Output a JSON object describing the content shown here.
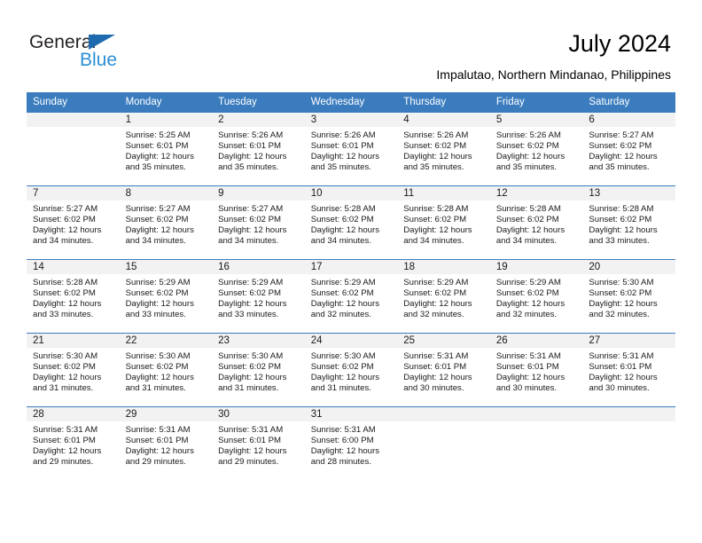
{
  "brand": {
    "name_top": "General",
    "name_bottom": "Blue",
    "color_dark": "#231f20",
    "color_blue": "#2b8fd4",
    "triangle_color": "#1f6bb0"
  },
  "header": {
    "title": "July 2024",
    "subtitle": "Impalutao, Northern Mindanao, Philippines"
  },
  "theme": {
    "header_bg": "#3a7cbe",
    "header_text": "#ffffff",
    "daynum_bg": "#f2f2f2",
    "grid_line": "#3a7cbe"
  },
  "calendar": {
    "weekday_headers": [
      "Sunday",
      "Monday",
      "Tuesday",
      "Wednesday",
      "Thursday",
      "Friday",
      "Saturday"
    ],
    "weeks": [
      [
        {
          "day": "",
          "sunrise": "",
          "sunset": "",
          "daylight_line1": "",
          "daylight_line2": ""
        },
        {
          "day": "1",
          "sunrise": "Sunrise: 5:25 AM",
          "sunset": "Sunset: 6:01 PM",
          "daylight_line1": "Daylight: 12 hours",
          "daylight_line2": "and 35 minutes."
        },
        {
          "day": "2",
          "sunrise": "Sunrise: 5:26 AM",
          "sunset": "Sunset: 6:01 PM",
          "daylight_line1": "Daylight: 12 hours",
          "daylight_line2": "and 35 minutes."
        },
        {
          "day": "3",
          "sunrise": "Sunrise: 5:26 AM",
          "sunset": "Sunset: 6:01 PM",
          "daylight_line1": "Daylight: 12 hours",
          "daylight_line2": "and 35 minutes."
        },
        {
          "day": "4",
          "sunrise": "Sunrise: 5:26 AM",
          "sunset": "Sunset: 6:02 PM",
          "daylight_line1": "Daylight: 12 hours",
          "daylight_line2": "and 35 minutes."
        },
        {
          "day": "5",
          "sunrise": "Sunrise: 5:26 AM",
          "sunset": "Sunset: 6:02 PM",
          "daylight_line1": "Daylight: 12 hours",
          "daylight_line2": "and 35 minutes."
        },
        {
          "day": "6",
          "sunrise": "Sunrise: 5:27 AM",
          "sunset": "Sunset: 6:02 PM",
          "daylight_line1": "Daylight: 12 hours",
          "daylight_line2": "and 35 minutes."
        }
      ],
      [
        {
          "day": "7",
          "sunrise": "Sunrise: 5:27 AM",
          "sunset": "Sunset: 6:02 PM",
          "daylight_line1": "Daylight: 12 hours",
          "daylight_line2": "and 34 minutes."
        },
        {
          "day": "8",
          "sunrise": "Sunrise: 5:27 AM",
          "sunset": "Sunset: 6:02 PM",
          "daylight_line1": "Daylight: 12 hours",
          "daylight_line2": "and 34 minutes."
        },
        {
          "day": "9",
          "sunrise": "Sunrise: 5:27 AM",
          "sunset": "Sunset: 6:02 PM",
          "daylight_line1": "Daylight: 12 hours",
          "daylight_line2": "and 34 minutes."
        },
        {
          "day": "10",
          "sunrise": "Sunrise: 5:28 AM",
          "sunset": "Sunset: 6:02 PM",
          "daylight_line1": "Daylight: 12 hours",
          "daylight_line2": "and 34 minutes."
        },
        {
          "day": "11",
          "sunrise": "Sunrise: 5:28 AM",
          "sunset": "Sunset: 6:02 PM",
          "daylight_line1": "Daylight: 12 hours",
          "daylight_line2": "and 34 minutes."
        },
        {
          "day": "12",
          "sunrise": "Sunrise: 5:28 AM",
          "sunset": "Sunset: 6:02 PM",
          "daylight_line1": "Daylight: 12 hours",
          "daylight_line2": "and 34 minutes."
        },
        {
          "day": "13",
          "sunrise": "Sunrise: 5:28 AM",
          "sunset": "Sunset: 6:02 PM",
          "daylight_line1": "Daylight: 12 hours",
          "daylight_line2": "and 33 minutes."
        }
      ],
      [
        {
          "day": "14",
          "sunrise": "Sunrise: 5:28 AM",
          "sunset": "Sunset: 6:02 PM",
          "daylight_line1": "Daylight: 12 hours",
          "daylight_line2": "and 33 minutes."
        },
        {
          "day": "15",
          "sunrise": "Sunrise: 5:29 AM",
          "sunset": "Sunset: 6:02 PM",
          "daylight_line1": "Daylight: 12 hours",
          "daylight_line2": "and 33 minutes."
        },
        {
          "day": "16",
          "sunrise": "Sunrise: 5:29 AM",
          "sunset": "Sunset: 6:02 PM",
          "daylight_line1": "Daylight: 12 hours",
          "daylight_line2": "and 33 minutes."
        },
        {
          "day": "17",
          "sunrise": "Sunrise: 5:29 AM",
          "sunset": "Sunset: 6:02 PM",
          "daylight_line1": "Daylight: 12 hours",
          "daylight_line2": "and 32 minutes."
        },
        {
          "day": "18",
          "sunrise": "Sunrise: 5:29 AM",
          "sunset": "Sunset: 6:02 PM",
          "daylight_line1": "Daylight: 12 hours",
          "daylight_line2": "and 32 minutes."
        },
        {
          "day": "19",
          "sunrise": "Sunrise: 5:29 AM",
          "sunset": "Sunset: 6:02 PM",
          "daylight_line1": "Daylight: 12 hours",
          "daylight_line2": "and 32 minutes."
        },
        {
          "day": "20",
          "sunrise": "Sunrise: 5:30 AM",
          "sunset": "Sunset: 6:02 PM",
          "daylight_line1": "Daylight: 12 hours",
          "daylight_line2": "and 32 minutes."
        }
      ],
      [
        {
          "day": "21",
          "sunrise": "Sunrise: 5:30 AM",
          "sunset": "Sunset: 6:02 PM",
          "daylight_line1": "Daylight: 12 hours",
          "daylight_line2": "and 31 minutes."
        },
        {
          "day": "22",
          "sunrise": "Sunrise: 5:30 AM",
          "sunset": "Sunset: 6:02 PM",
          "daylight_line1": "Daylight: 12 hours",
          "daylight_line2": "and 31 minutes."
        },
        {
          "day": "23",
          "sunrise": "Sunrise: 5:30 AM",
          "sunset": "Sunset: 6:02 PM",
          "daylight_line1": "Daylight: 12 hours",
          "daylight_line2": "and 31 minutes."
        },
        {
          "day": "24",
          "sunrise": "Sunrise: 5:30 AM",
          "sunset": "Sunset: 6:02 PM",
          "daylight_line1": "Daylight: 12 hours",
          "daylight_line2": "and 31 minutes."
        },
        {
          "day": "25",
          "sunrise": "Sunrise: 5:31 AM",
          "sunset": "Sunset: 6:01 PM",
          "daylight_line1": "Daylight: 12 hours",
          "daylight_line2": "and 30 minutes."
        },
        {
          "day": "26",
          "sunrise": "Sunrise: 5:31 AM",
          "sunset": "Sunset: 6:01 PM",
          "daylight_line1": "Daylight: 12 hours",
          "daylight_line2": "and 30 minutes."
        },
        {
          "day": "27",
          "sunrise": "Sunrise: 5:31 AM",
          "sunset": "Sunset: 6:01 PM",
          "daylight_line1": "Daylight: 12 hours",
          "daylight_line2": "and 30 minutes."
        }
      ],
      [
        {
          "day": "28",
          "sunrise": "Sunrise: 5:31 AM",
          "sunset": "Sunset: 6:01 PM",
          "daylight_line1": "Daylight: 12 hours",
          "daylight_line2": "and 29 minutes."
        },
        {
          "day": "29",
          "sunrise": "Sunrise: 5:31 AM",
          "sunset": "Sunset: 6:01 PM",
          "daylight_line1": "Daylight: 12 hours",
          "daylight_line2": "and 29 minutes."
        },
        {
          "day": "30",
          "sunrise": "Sunrise: 5:31 AM",
          "sunset": "Sunset: 6:01 PM",
          "daylight_line1": "Daylight: 12 hours",
          "daylight_line2": "and 29 minutes."
        },
        {
          "day": "31",
          "sunrise": "Sunrise: 5:31 AM",
          "sunset": "Sunset: 6:00 PM",
          "daylight_line1": "Daylight: 12 hours",
          "daylight_line2": "and 28 minutes."
        },
        {
          "day": "",
          "sunrise": "",
          "sunset": "",
          "daylight_line1": "",
          "daylight_line2": ""
        },
        {
          "day": "",
          "sunrise": "",
          "sunset": "",
          "daylight_line1": "",
          "daylight_line2": ""
        },
        {
          "day": "",
          "sunrise": "",
          "sunset": "",
          "daylight_line1": "",
          "daylight_line2": ""
        }
      ]
    ]
  }
}
